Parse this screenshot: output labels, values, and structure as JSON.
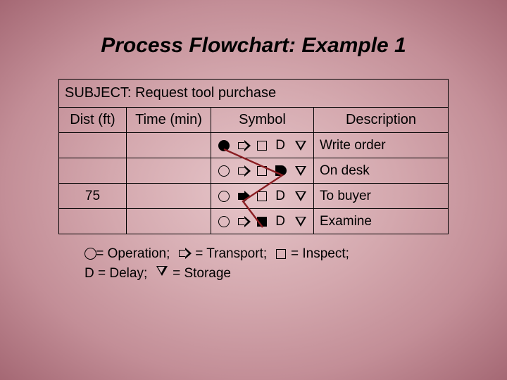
{
  "title": "Process Flowchart: Example 1",
  "subject_label": "SUBJECT:",
  "subject_value": "Request tool purchase",
  "headers": {
    "dist": "Dist (ft)",
    "time": "Time (min)",
    "symbol": "Symbol",
    "desc": "Description"
  },
  "rows": [
    {
      "dist": "",
      "time": "",
      "desc": "Write order",
      "active": 0
    },
    {
      "dist": "",
      "time": "",
      "desc": "On desk",
      "active": 3
    },
    {
      "dist": "75",
      "time": "",
      "desc": "To buyer",
      "active": 1
    },
    {
      "dist": "",
      "time": "",
      "desc": "Examine",
      "active": 2
    }
  ],
  "symbols": [
    "operation",
    "transport",
    "inspect",
    "delay",
    "storage"
  ],
  "legend": {
    "operation": "= Operation;",
    "transport": "= Transport;",
    "inspect": " = Inspect;",
    "delay": "D = Delay;",
    "storage": " = Storage"
  },
  "chart_data": {
    "type": "table",
    "title": "Process Flowchart: Example 1",
    "subject": "Request tool purchase",
    "columns": [
      "Dist (ft)",
      "Time (min)",
      "Symbol",
      "Description"
    ],
    "symbol_order": [
      "Operation",
      "Transport",
      "Inspect",
      "Delay",
      "Storage"
    ],
    "steps": [
      {
        "dist_ft": null,
        "time_min": null,
        "active_symbol": "Operation",
        "description": "Write order"
      },
      {
        "dist_ft": null,
        "time_min": null,
        "active_symbol": "Delay",
        "description": "On desk"
      },
      {
        "dist_ft": 75,
        "time_min": null,
        "active_symbol": "Transport",
        "description": "To buyer"
      },
      {
        "dist_ft": null,
        "time_min": null,
        "active_symbol": "Inspect",
        "description": "Examine"
      }
    ],
    "legend": {
      "Operation": "circle",
      "Transport": "right-arrow",
      "Inspect": "square",
      "Delay": "D",
      "Storage": "inverted-triangle"
    }
  }
}
